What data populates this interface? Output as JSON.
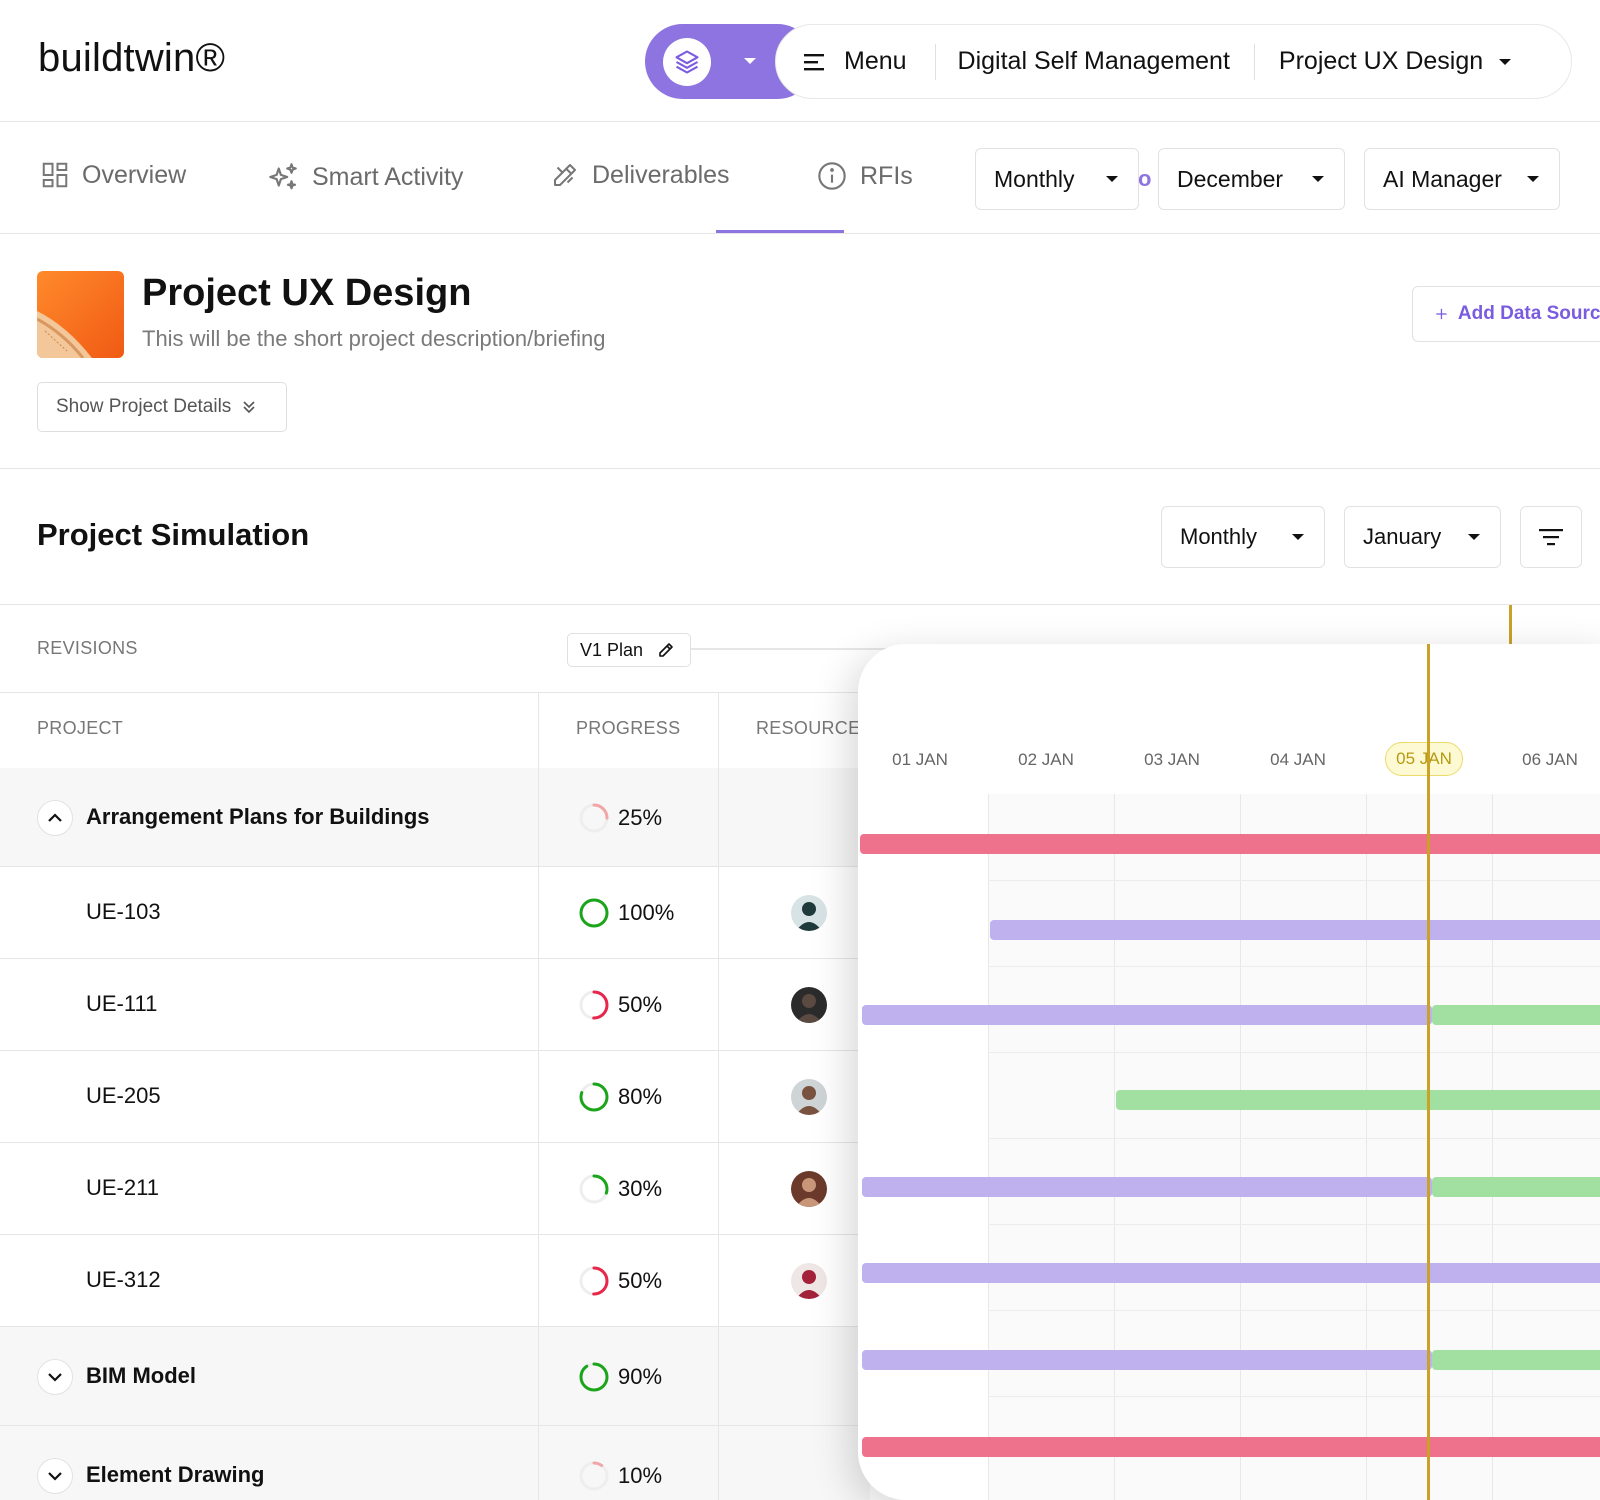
{
  "app": {
    "logo": "buildtwin®",
    "nav": {
      "menu_label": "Menu",
      "workspace": "Digital Self Management",
      "project": "Project UX Design"
    }
  },
  "tabs": [
    {
      "label": "Overview",
      "icon": "dashboard-icon",
      "active": false
    },
    {
      "label": "Smart Activity",
      "icon": "sparkles-icon",
      "active": false
    },
    {
      "label": "Deliverables",
      "icon": "pencil-ruler-icon",
      "active": true
    },
    {
      "label": "RFIs",
      "icon": "info-icon",
      "active": false
    }
  ],
  "filters": {
    "period": "Monthly",
    "fragment": "o",
    "month": "December",
    "manager": "AI Manager"
  },
  "project": {
    "title": "Project UX Design",
    "description": "This will be the short project description/briefing",
    "details_button": "Show Project Details",
    "add_datasource": "Add Data Source"
  },
  "simulation": {
    "title": "Project Simulation",
    "period": "Monthly",
    "month": "January",
    "revisions_label": "REVISIONS",
    "revision": "V1 Plan",
    "columns": {
      "project": "PROJECT",
      "progress": "PROGRESS",
      "resources": "RESOURCE"
    },
    "rows": [
      {
        "label": "Arrangement Plans for Buildings",
        "progress": "25%",
        "pct": 25,
        "color": "#f2a7a7",
        "group": true,
        "expanded": true
      },
      {
        "label": "UE-103",
        "progress": "100%",
        "pct": 100,
        "color": "#1aa51a",
        "group": false,
        "avatar": "avatar-1"
      },
      {
        "label": "UE-111",
        "progress": "50%",
        "pct": 50,
        "color": "#e8264a",
        "group": false,
        "avatar": "avatar-2"
      },
      {
        "label": "UE-205",
        "progress": "80%",
        "pct": 80,
        "color": "#1aa51a",
        "group": false,
        "avatar": "avatar-3"
      },
      {
        "label": "UE-211",
        "progress": "30%",
        "pct": 30,
        "color": "#1aa51a",
        "group": false,
        "avatar": "avatar-4"
      },
      {
        "label": "UE-312",
        "progress": "50%",
        "pct": 50,
        "color": "#e8264a",
        "group": false,
        "avatar": "avatar-5"
      },
      {
        "label": "BIM Model",
        "progress": "90%",
        "pct": 90,
        "color": "#1aa51a",
        "group": true,
        "expanded": false
      },
      {
        "label": "Element Drawing",
        "progress": "10%",
        "pct": 10,
        "color": "#f2a7a7",
        "group": true,
        "expanded": false
      }
    ]
  },
  "gantt": {
    "dates": [
      "01 JAN",
      "02 JAN",
      "03 JAN",
      "04 JAN",
      "05 JAN",
      "06 JAN"
    ],
    "today": "05 JAN",
    "colors": {
      "planned": "#bfb0ee",
      "done": "#a2e0a2",
      "critical": "#ee728c",
      "today": "#c9a227"
    }
  }
}
